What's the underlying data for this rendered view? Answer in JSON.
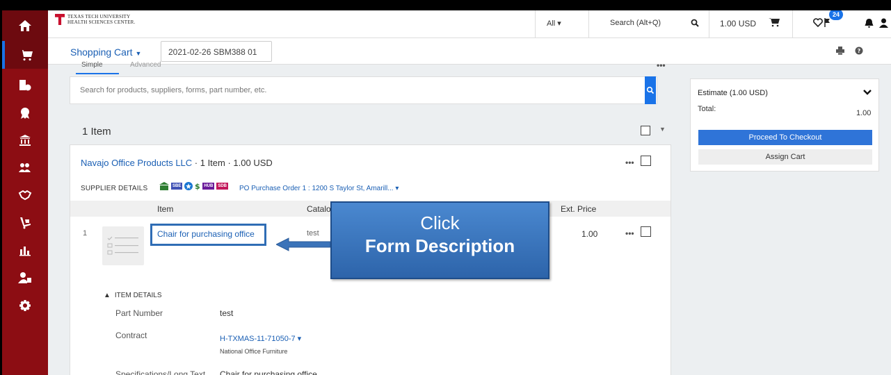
{
  "brand": {
    "line1": "TEXAS TECH UNIVERSITY",
    "line2": "HEALTH SCIENCES CENTER."
  },
  "topbar": {
    "scope": "All ▾",
    "search_placeholder": "Search (Alt+Q)",
    "cart_total": "1.00 USD",
    "notification_count": "24"
  },
  "cart": {
    "title": "Shopping Cart",
    "name": "2021-02-26 SBM388 01"
  },
  "tabs": {
    "simple": "Simple",
    "advanced": "Advanced"
  },
  "search": {
    "placeholder": "Search for products, suppliers, forms, part number, etc."
  },
  "items_count": "1 Item",
  "supplier": {
    "name": "Navajo Office Products LLC",
    "summary": " · 1 Item  · 1.00 USD",
    "details_label": "SUPPLIER DETAILS",
    "badges": [
      "SBE",
      "HUB",
      "SDB"
    ],
    "po_link": "PO Purchase Order 1 : 1200 S Taylor St, Amarill... ▾"
  },
  "table": {
    "col_item": "Item",
    "col_catalog": "Catalog",
    "col_ext_price": "Ext. Price"
  },
  "line_item": {
    "number": "1",
    "description": "Chair for purchasing office",
    "catalog": "test",
    "ext_price": "1.00"
  },
  "callout": {
    "line1": "Click",
    "line2": "Form Description"
  },
  "item_details": {
    "toggle": "ITEM DETAILS",
    "part_number_label": "Part Number",
    "part_number": "test",
    "contract_label": "Contract",
    "contract": "H-TXMAS-11-71050-7 ▾",
    "contract_name": "National Office Furniture",
    "spec_label": "Specifications/Long Text",
    "spec": "Chair for purchasing office"
  },
  "summary": {
    "estimate": "Estimate (1.00 USD)",
    "total_label": "Total:",
    "total": "1.00",
    "checkout": "Proceed To Checkout",
    "assign": "Assign Cart"
  }
}
